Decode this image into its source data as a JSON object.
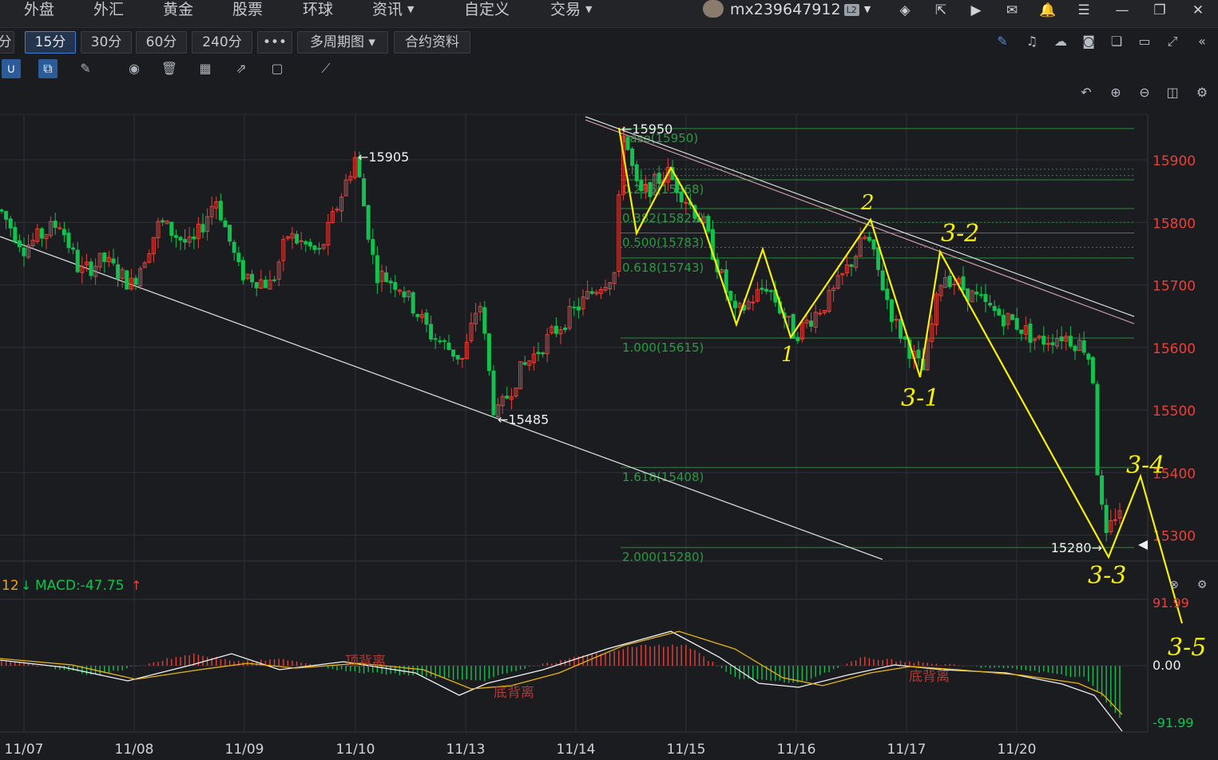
{
  "menu": {
    "items": [
      {
        "label": "外盘",
        "caret": false
      },
      {
        "label": "外汇",
        "caret": false
      },
      {
        "label": "黄金",
        "caret": false
      },
      {
        "label": "股票",
        "caret": false
      },
      {
        "label": "环球",
        "caret": false
      },
      {
        "label": "资讯",
        "caret": true
      },
      {
        "label": "自定义",
        "caret": false
      },
      {
        "label": "交易",
        "caret": true
      }
    ],
    "user": "mx239647912",
    "user_level": "L2",
    "icons": [
      "layers-icon",
      "share-icon",
      "video-icon",
      "mail-icon",
      "bell-icon",
      "menu-icon",
      "minimize-icon",
      "restore-icon",
      "close-icon"
    ]
  },
  "periods": {
    "buttons": [
      "分",
      "15分",
      "30分",
      "60分",
      "240分",
      "•••",
      "多周期图 ▾",
      "合约资料"
    ],
    "active": "15分"
  },
  "toolbar_right_icons": [
    "pen-icon",
    "alarm-icon",
    "cloud-icon",
    "camera-icon",
    "copy-icon",
    "monitor-icon",
    "fullscreen-icon",
    "collapse-icon"
  ],
  "draw_tools": [
    "magnet-icon",
    "clone-icon",
    "pencil-icon",
    "eye-icon",
    "trash-icon",
    "grid-icon",
    "export-icon",
    "comment-icon",
    "ruler-icon"
  ],
  "chart_controls": [
    "undo-icon",
    "zoom-in-icon",
    "zoom-out-icon",
    "layout-icon",
    "settings-icon"
  ],
  "colors": {
    "up": "#e8403a",
    "down": "#13c24e",
    "background": "#1b1c20",
    "annotation": "#f5f00a",
    "fib": "#2a8a3c",
    "grid": "#2e3036"
  },
  "chart_data": {
    "type": "candlestick",
    "price_axis": {
      "ticks": [
        15900,
        15800,
        15700,
        15600,
        15500,
        15400,
        15300
      ],
      "ylim": [
        15260,
        15970
      ]
    },
    "time_axis": {
      "labels": [
        "11/07",
        "11/08",
        "11/09",
        "11/10",
        "11/13",
        "11/14",
        "11/15",
        "11/16",
        "11/17",
        "11/20"
      ]
    },
    "price_path": [
      [
        0,
        15820
      ],
      [
        30,
        15760
      ],
      [
        75,
        15800
      ],
      [
        100,
        15720
      ],
      [
        130,
        15740
      ],
      [
        165,
        15700
      ],
      [
        200,
        15800
      ],
      [
        240,
        15760
      ],
      [
        270,
        15840
      ],
      [
        300,
        15720
      ],
      [
        340,
        15700
      ],
      [
        360,
        15780
      ],
      [
        400,
        15750
      ],
      [
        445,
        15905
      ],
      [
        470,
        15720
      ],
      [
        500,
        15700
      ],
      [
        540,
        15620
      ],
      [
        580,
        15580
      ],
      [
        600,
        15680
      ],
      [
        620,
        15485
      ],
      [
        650,
        15560
      ],
      [
        690,
        15620
      ],
      [
        720,
        15660
      ],
      [
        750,
        15700
      ],
      [
        770,
        15720
      ],
      [
        780,
        15950
      ],
      [
        800,
        15840
      ],
      [
        835,
        15880
      ],
      [
        880,
        15800
      ],
      [
        920,
        15650
      ],
      [
        960,
        15700
      ],
      [
        995,
        15620
      ],
      [
        1040,
        15680
      ],
      [
        1085,
        15780
      ],
      [
        1120,
        15640
      ],
      [
        1155,
        15560
      ],
      [
        1180,
        15720
      ],
      [
        1210,
        15690
      ],
      [
        1240,
        15660
      ],
      [
        1270,
        15640
      ],
      [
        1300,
        15610
      ],
      [
        1330,
        15620
      ],
      [
        1360,
        15600
      ],
      [
        1368,
        15560
      ],
      [
        1375,
        15380
      ],
      [
        1385,
        15290
      ],
      [
        1395,
        15330
      ],
      [
        1405,
        15350
      ]
    ],
    "price_labels": [
      {
        "text": "←15905",
        "price": 15905
      },
      {
        "text": "←15485",
        "price": 15485
      },
      {
        "text": "←15950",
        "price": 15950
      },
      {
        "text": "15280→",
        "price": 15280
      }
    ],
    "fibonacci": [
      {
        "label": "base(15950)",
        "price": 15950
      },
      {
        "label": "0.236(15868)",
        "price": 15868
      },
      {
        "label": "0.382(15822)",
        "price": 15822
      },
      {
        "label": "0.500(15783)",
        "price": 15783
      },
      {
        "label": "0.618(15743)",
        "price": 15743
      },
      {
        "label": "1.000(15615)",
        "price": 15615
      },
      {
        "label": "1.618(15408)",
        "price": 15408
      },
      {
        "label": "2.000(15280)",
        "price": 15280
      }
    ],
    "wave_labels": [
      "1",
      "2",
      "3-1",
      "3-2",
      "3-3",
      "3-4",
      "3-5"
    ],
    "macd": {
      "label": "MACD:-47.75",
      "ticks": [
        "91.99",
        "0.00",
        "-91.99"
      ],
      "divergence_labels": [
        "顶背离",
        "底背离",
        "底背离"
      ]
    },
    "indicator_prefix": "12"
  }
}
